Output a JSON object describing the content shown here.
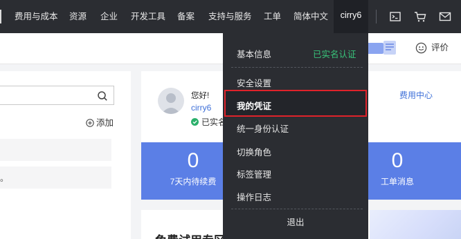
{
  "topnav": {
    "items": [
      "费用与成本",
      "资源",
      "企业",
      "开发工具",
      "备案",
      "支持与服务",
      "工单",
      "简体中文"
    ],
    "user": "cirry6"
  },
  "subheader": {
    "rate_label": "评价"
  },
  "left": {
    "add_label": "添加",
    "row2_text": "。"
  },
  "profile": {
    "greeting": "您好!",
    "username": "cirry6",
    "verified_text": "已实名",
    "fee_center": "费用中心"
  },
  "stats": [
    {
      "value": "0",
      "label": "7天内待续费"
    },
    {
      "value": "0",
      "label": "工单消息"
    }
  ],
  "card2_title": "免费试用专区",
  "dropdown": {
    "basic_info": "基本信息",
    "verified_status": "已实名认证",
    "items": [
      "安全设置",
      "我的凭证",
      "统一身份认证",
      "切换角色",
      "标签管理",
      "操作日志"
    ],
    "selected": "我的凭证",
    "logout": "退出"
  },
  "colors": {
    "nav_bg": "#2b2d32",
    "accent_blue": "#5b7fe6",
    "link_blue": "#3d6fd8",
    "verified_green": "#38c47a",
    "highlight_red": "#e0222a"
  }
}
